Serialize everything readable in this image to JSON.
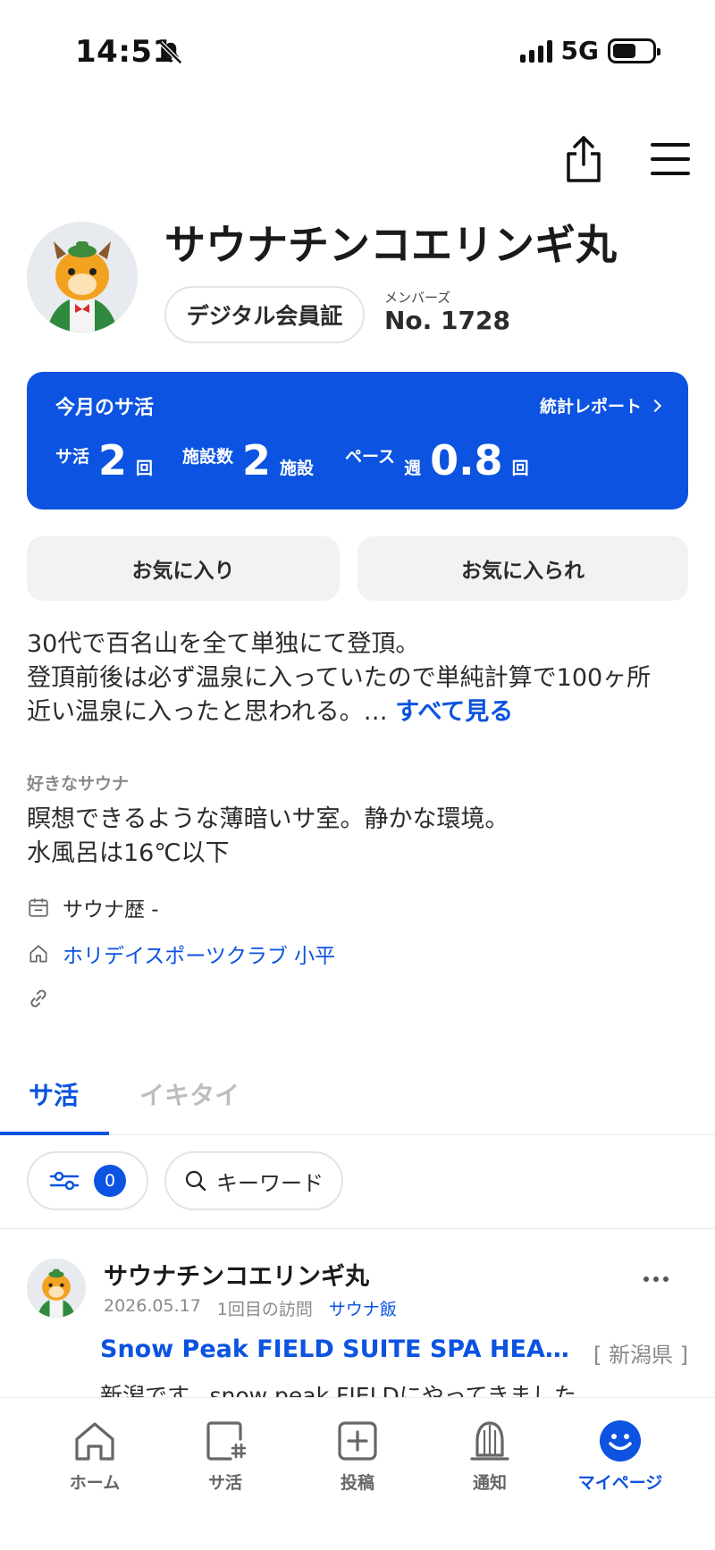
{
  "status_bar": {
    "time": "14:51",
    "network": "5G"
  },
  "profile": {
    "name": "サウナチンコエリンギ丸",
    "card_button": "デジタル会員証",
    "member_label": "メンバーズ",
    "member_no": "No. 1728"
  },
  "sakatsu_card": {
    "title": "今月のサ活",
    "report_link": "統計レポート",
    "stats": [
      {
        "label": "サ活",
        "prefix": "",
        "value": "2",
        "unit": "回"
      },
      {
        "label": "施設数",
        "prefix": "",
        "value": "2",
        "unit": "施設"
      },
      {
        "label": "ペース",
        "prefix": "週",
        "value": "0.8",
        "unit": "回"
      }
    ]
  },
  "buttons": {
    "favorites": "お気に入り",
    "favorited": "お気に入られ"
  },
  "bio": {
    "line1": "30代で百名山を全て単独にて登頂。",
    "line2": "登頂前後は必ず温泉に入っていたので単純計算で100ヶ所",
    "line3": "近い温泉に入ったと思われる。…",
    "more": "すべて見る"
  },
  "favorite_sauna": {
    "label": "好きなサウナ",
    "line1": "瞑想できるような薄暗いサ室。静かな環境。",
    "line2": "水風呂は16℃以下"
  },
  "info": {
    "sauna_history": "サウナ歴 -",
    "home_facility": "ホリデイスポーツクラブ 小平"
  },
  "tabs": {
    "active": "サ活",
    "inactive": "イキタイ"
  },
  "filter": {
    "count": "0",
    "keyword_placeholder": "キーワード"
  },
  "post": {
    "author": "サウナチンコエリンギ丸",
    "date": "2026.05.17",
    "visit": "1回目の訪問",
    "tag": "サウナ飯",
    "facility": "Snow Peak FIELD SUITE SPA HEADQ…",
    "prefecture": "[ 新潟県 ]",
    "body": "新潟です。snow peak FIELDにやってきました"
  },
  "bottom_nav": {
    "items": [
      {
        "label": "ホーム"
      },
      {
        "label": "サ活"
      },
      {
        "label": "投稿"
      },
      {
        "label": "通知"
      },
      {
        "label": "マイページ"
      }
    ]
  },
  "colors": {
    "accent": "#0b53e0",
    "muted": "#8a8a8a",
    "button_bg": "#f2f2f2"
  }
}
